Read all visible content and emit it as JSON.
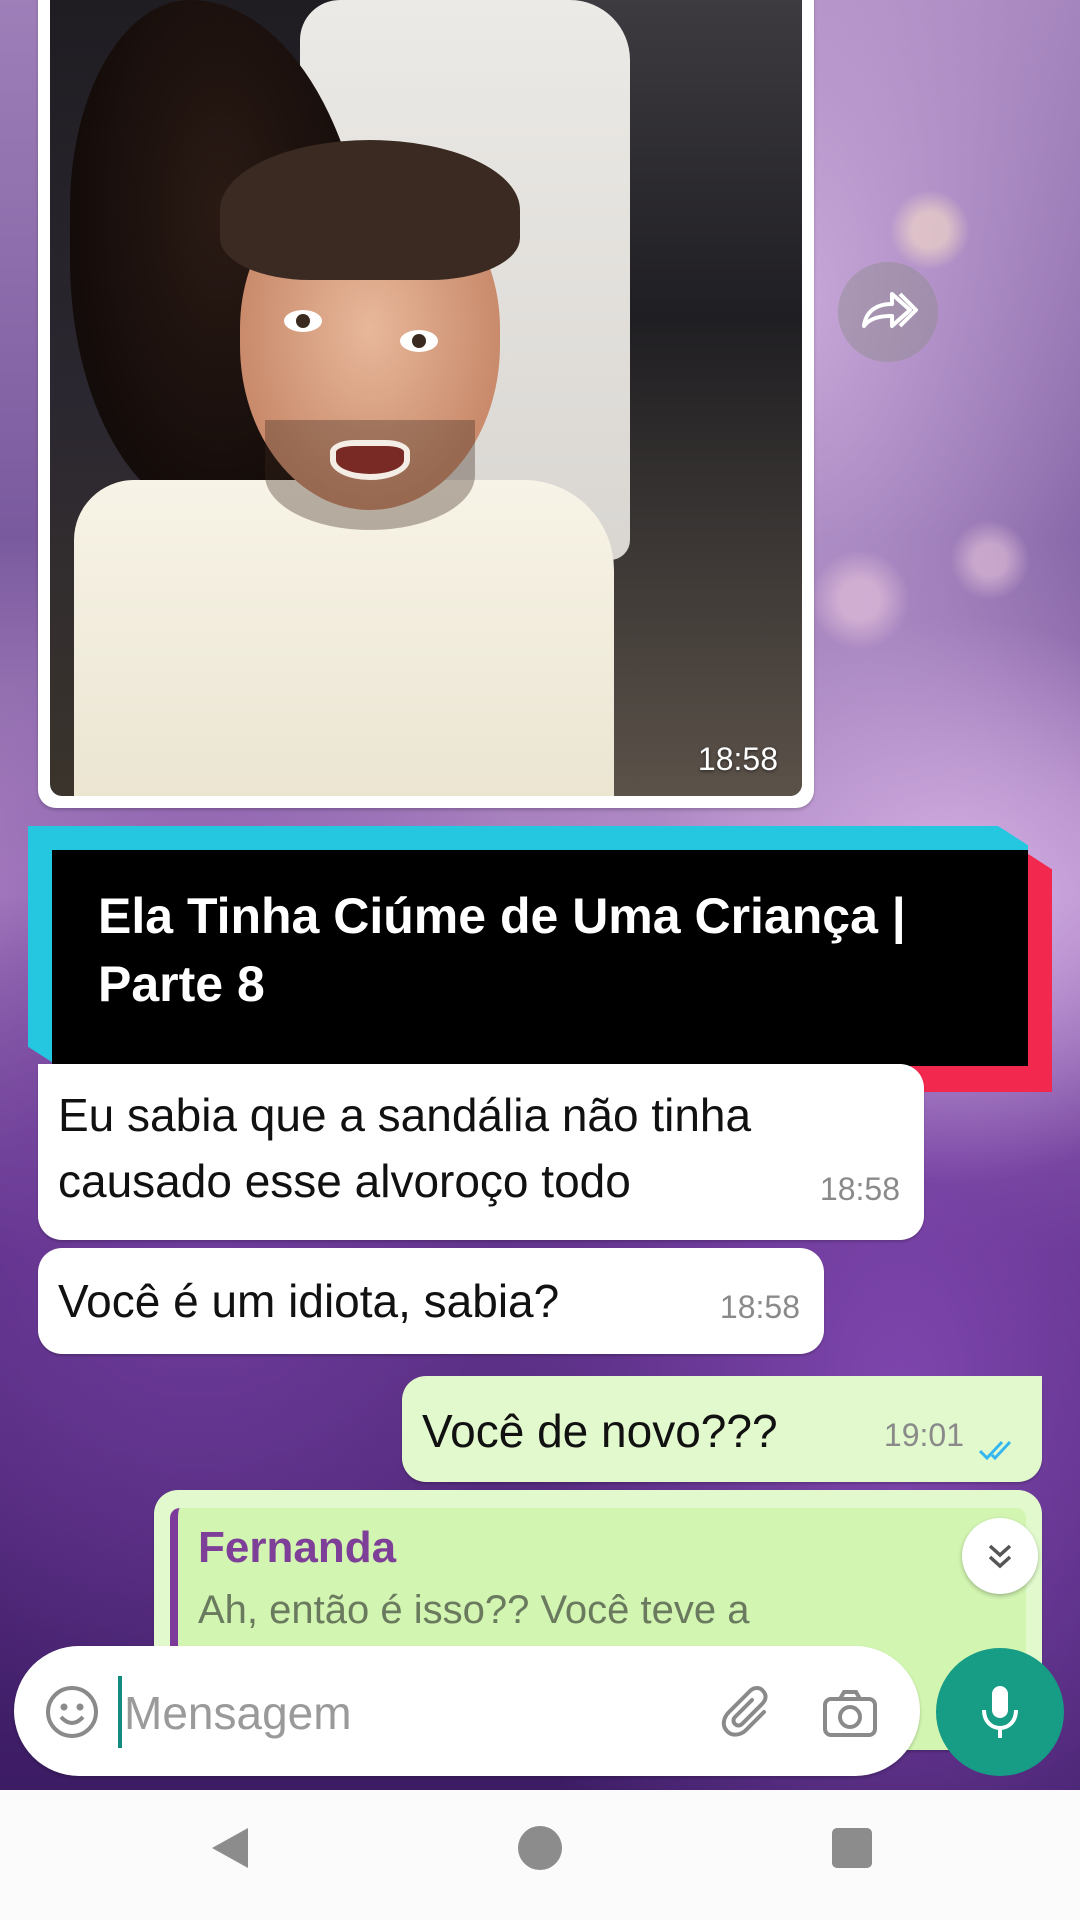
{
  "image_message": {
    "time": "18:58"
  },
  "banner": {
    "title": "Ela Tinha Ciúme de Uma Criança | Parte 8"
  },
  "messages": [
    {
      "direction": "incoming",
      "text": "Eu sabia que a sandália não tinha causado esse alvoroço todo",
      "time": "18:58"
    },
    {
      "direction": "incoming",
      "text": "Você é um idiota, sabia?",
      "time": "18:58"
    },
    {
      "direction": "outgoing",
      "text": "Você de novo???",
      "time": "19:01",
      "status": "read"
    }
  ],
  "reply_message": {
    "quoted_name": "Fernanda",
    "quoted_text": "Ah, então é isso?? Você teve a"
  },
  "composer": {
    "placeholder": "Mensagem",
    "value": ""
  },
  "colors": {
    "accent": "#179c85",
    "outgoing_bubble": "#e1f9cc",
    "banner_cyan": "#25c6e0",
    "banner_red": "#f2284e",
    "quote_name": "#7d3f98",
    "read_ticks": "#34b7f1"
  },
  "icons": {
    "forward": "forward-icon",
    "scroll_down": "double-chevron-down-icon",
    "emoji": "emoji-icon",
    "attach": "paperclip-icon",
    "camera": "camera-icon",
    "mic": "microphone-icon",
    "nav_back": "back-triangle-icon",
    "nav_home": "home-circle-icon",
    "nav_recents": "recents-square-icon"
  }
}
